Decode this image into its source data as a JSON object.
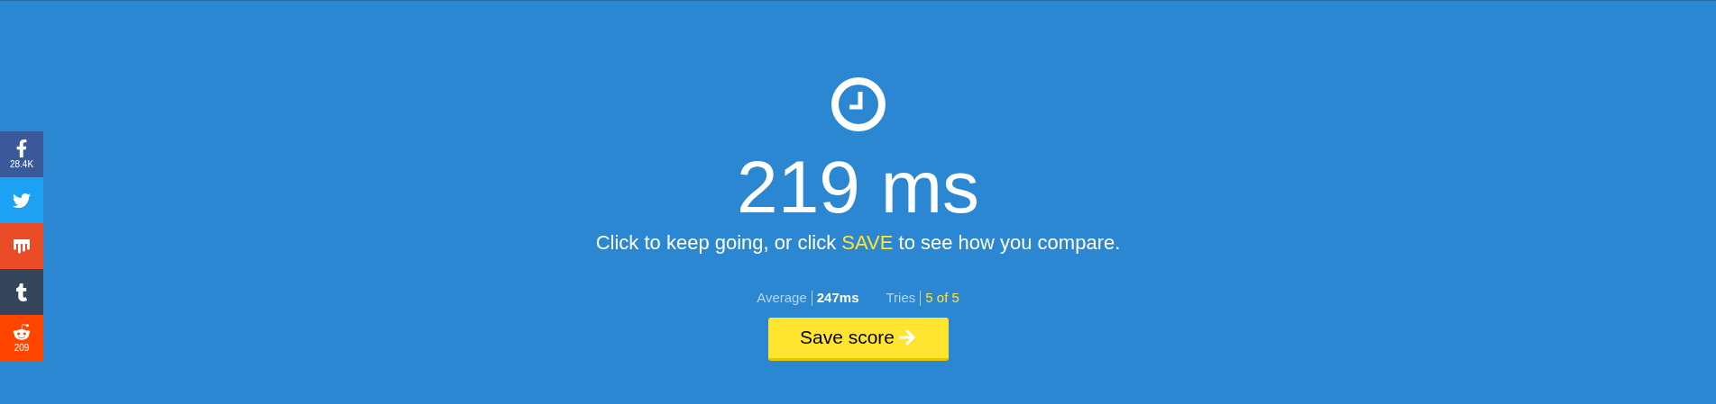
{
  "social": [
    {
      "kind": "facebook",
      "color": "#3b5998",
      "count": "28.4K"
    },
    {
      "kind": "twitter",
      "color": "#1da1f2"
    },
    {
      "kind": "mix",
      "color": "#e94b26"
    },
    {
      "kind": "tumblr",
      "color": "#35465c"
    },
    {
      "kind": "reddit",
      "color": "#ff4500",
      "count": "209"
    }
  ],
  "result": "219 ms",
  "message": {
    "before": "Click to keep going, or click ",
    "highlight": "SAVE",
    "after": " to see how you compare."
  },
  "stats": [
    {
      "label": "Average",
      "value": "247ms",
      "kind": "plain"
    },
    {
      "label": "Tries",
      "value": "5 of 5",
      "kind": "highlight"
    }
  ],
  "save_button": "Save score"
}
